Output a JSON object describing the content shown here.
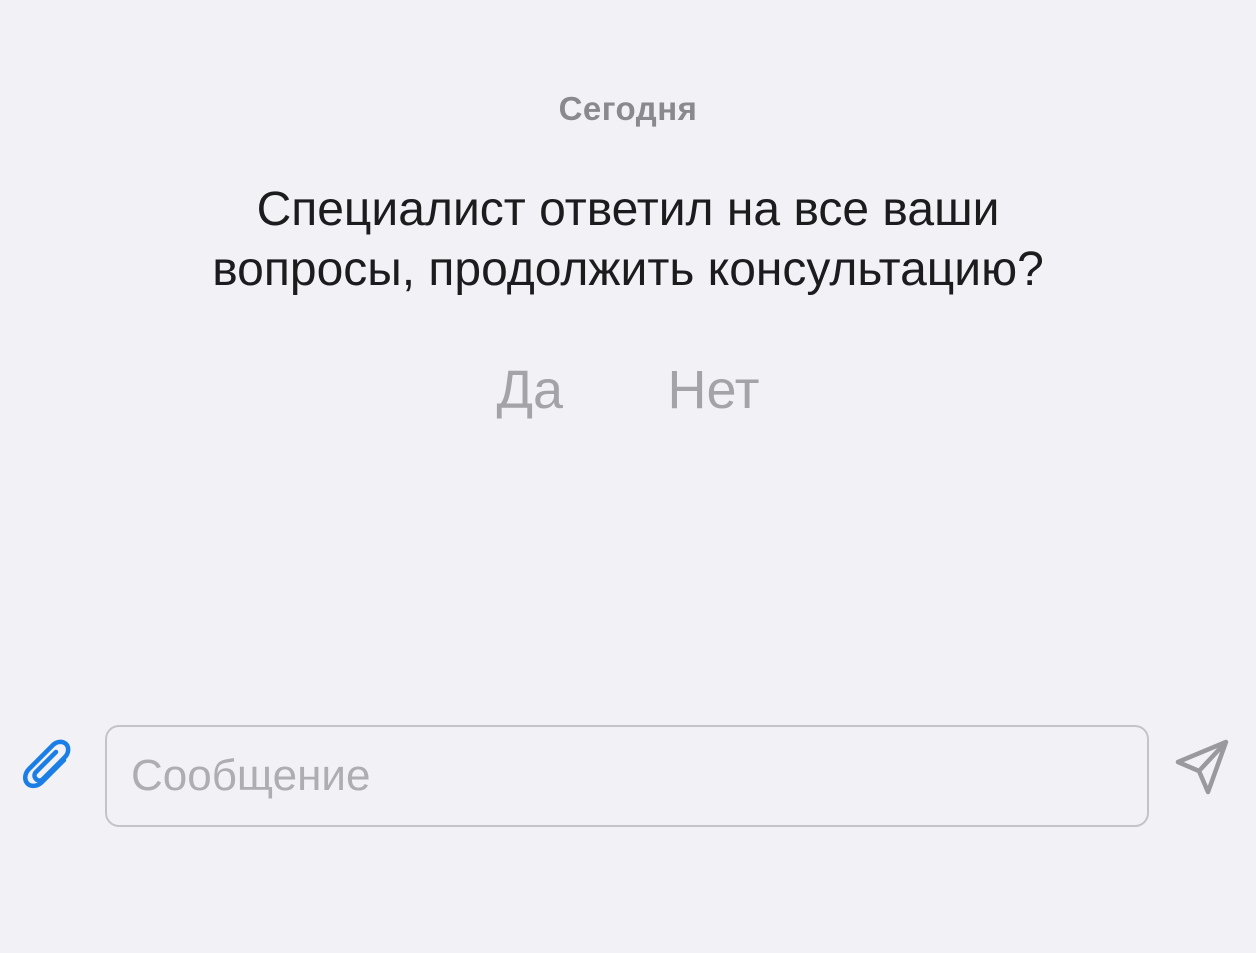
{
  "chat": {
    "date_label": "Сегодня",
    "question_line1": "Специалист ответил на все ваши",
    "question_line2": "вопросы, продолжить консультацию?",
    "answer_yes": "Да",
    "answer_no": "Нет"
  },
  "composer": {
    "placeholder": "Сообщение",
    "value": "",
    "attach_icon": "paperclip-icon",
    "send_icon": "send-icon"
  },
  "colors": {
    "background": "#f1f1f6",
    "accent": "#1a7ee6",
    "muted": "#a3a3a8"
  }
}
